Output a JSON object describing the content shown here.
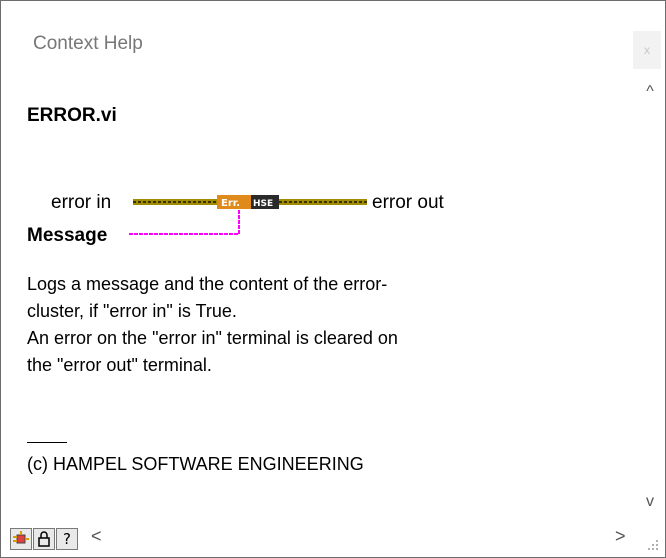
{
  "window": {
    "title": "Context Help",
    "close_glyph": "x"
  },
  "vi": {
    "name": "ERROR.vi",
    "connector": {
      "input_label": "error in",
      "output_label": "error out",
      "message_label": "Message",
      "icon_left_text": "Err.",
      "icon_right_text": "HSE"
    }
  },
  "description": {
    "line1": "Logs a message and the content of the error-",
    "line2": "cluster, if \"error in\" is True.",
    "line3": "An error on the \"error in\" terminal is cleared on",
    "line4": "the \"error out\" terminal."
  },
  "copyright": "(c) HAMPEL SOFTWARE ENGINEERING",
  "scrollbar": {
    "up_glyph": "^",
    "down_glyph": "v",
    "left_glyph": "<",
    "right_glyph": ">"
  },
  "toolbar": {
    "buttons": [
      {
        "name": "show-optional-terminals",
        "icon": "terminals-icon"
      },
      {
        "name": "lock-context-help",
        "icon": "lock-icon"
      },
      {
        "name": "detailed-help",
        "icon": "question-icon",
        "glyph": "?"
      }
    ]
  },
  "colors": {
    "error_wire": "#a08c00",
    "error_wire_dark": "#3a3000",
    "string_wire": "#ff00ff",
    "icon_orange": "#e08a1c",
    "icon_dark": "#2a2a2a"
  }
}
